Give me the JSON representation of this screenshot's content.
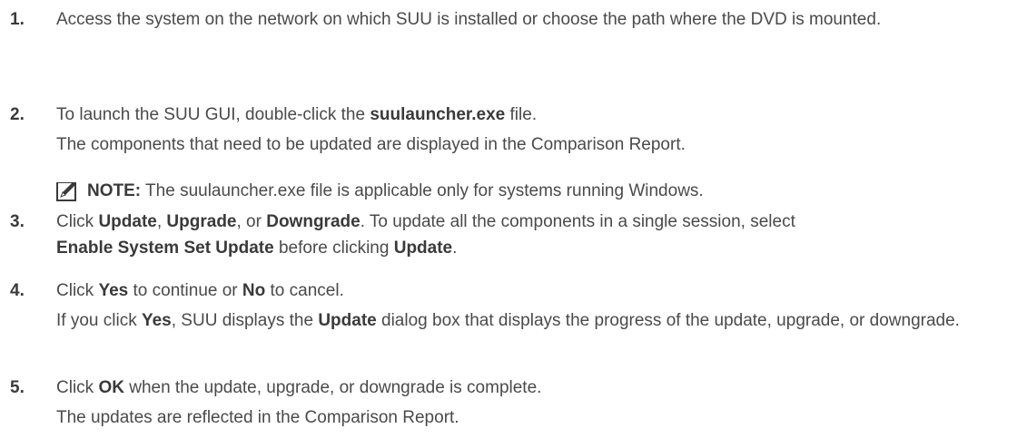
{
  "steps": [
    {
      "num": "1.",
      "line1": "Access the system on the network on which SUU is installed or choose the path where the DVD is mounted."
    },
    {
      "num": "2.",
      "line1_pre": "To launch the SUU GUI, double-click the ",
      "line1_bold": "suulauncher.exe",
      "line1_post": " file.",
      "line2": "The components that need to be updated are displayed in the Comparison Report.",
      "note_label": "NOTE:",
      "note_text": " The suulauncher.exe file is applicable only for systems running Windows.",
      "note_icon": "pencil-note-icon"
    },
    {
      "num": "3.",
      "click": "Click ",
      "update": "Update",
      "comma1": ", ",
      "upgrade": "Upgrade",
      "or": ", or ",
      "downgrade": "Downgrade",
      "mid": ". To update all the components in a single session, select ",
      "enable": "Enable System Set Update",
      "before": " before clicking ",
      "update2": "Update",
      "end": "."
    },
    {
      "num": "4.",
      "click": "Click ",
      "yes": "Yes",
      "mid": " to continue or ",
      "no": "No",
      "end": " to cancel.",
      "l2_pre": "If you click ",
      "l2_yes": "Yes",
      "l2_mid": ", SUU displays the ",
      "l2_update": "Update",
      "l2_post": " dialog box that displays the progress of the update, upgrade, or downgrade."
    },
    {
      "num": "5.",
      "click": "Click ",
      "ok": "OK",
      "end": " when the update, upgrade, or downgrade is complete.",
      "line2": "The updates are reflected in the Comparison Report."
    }
  ]
}
